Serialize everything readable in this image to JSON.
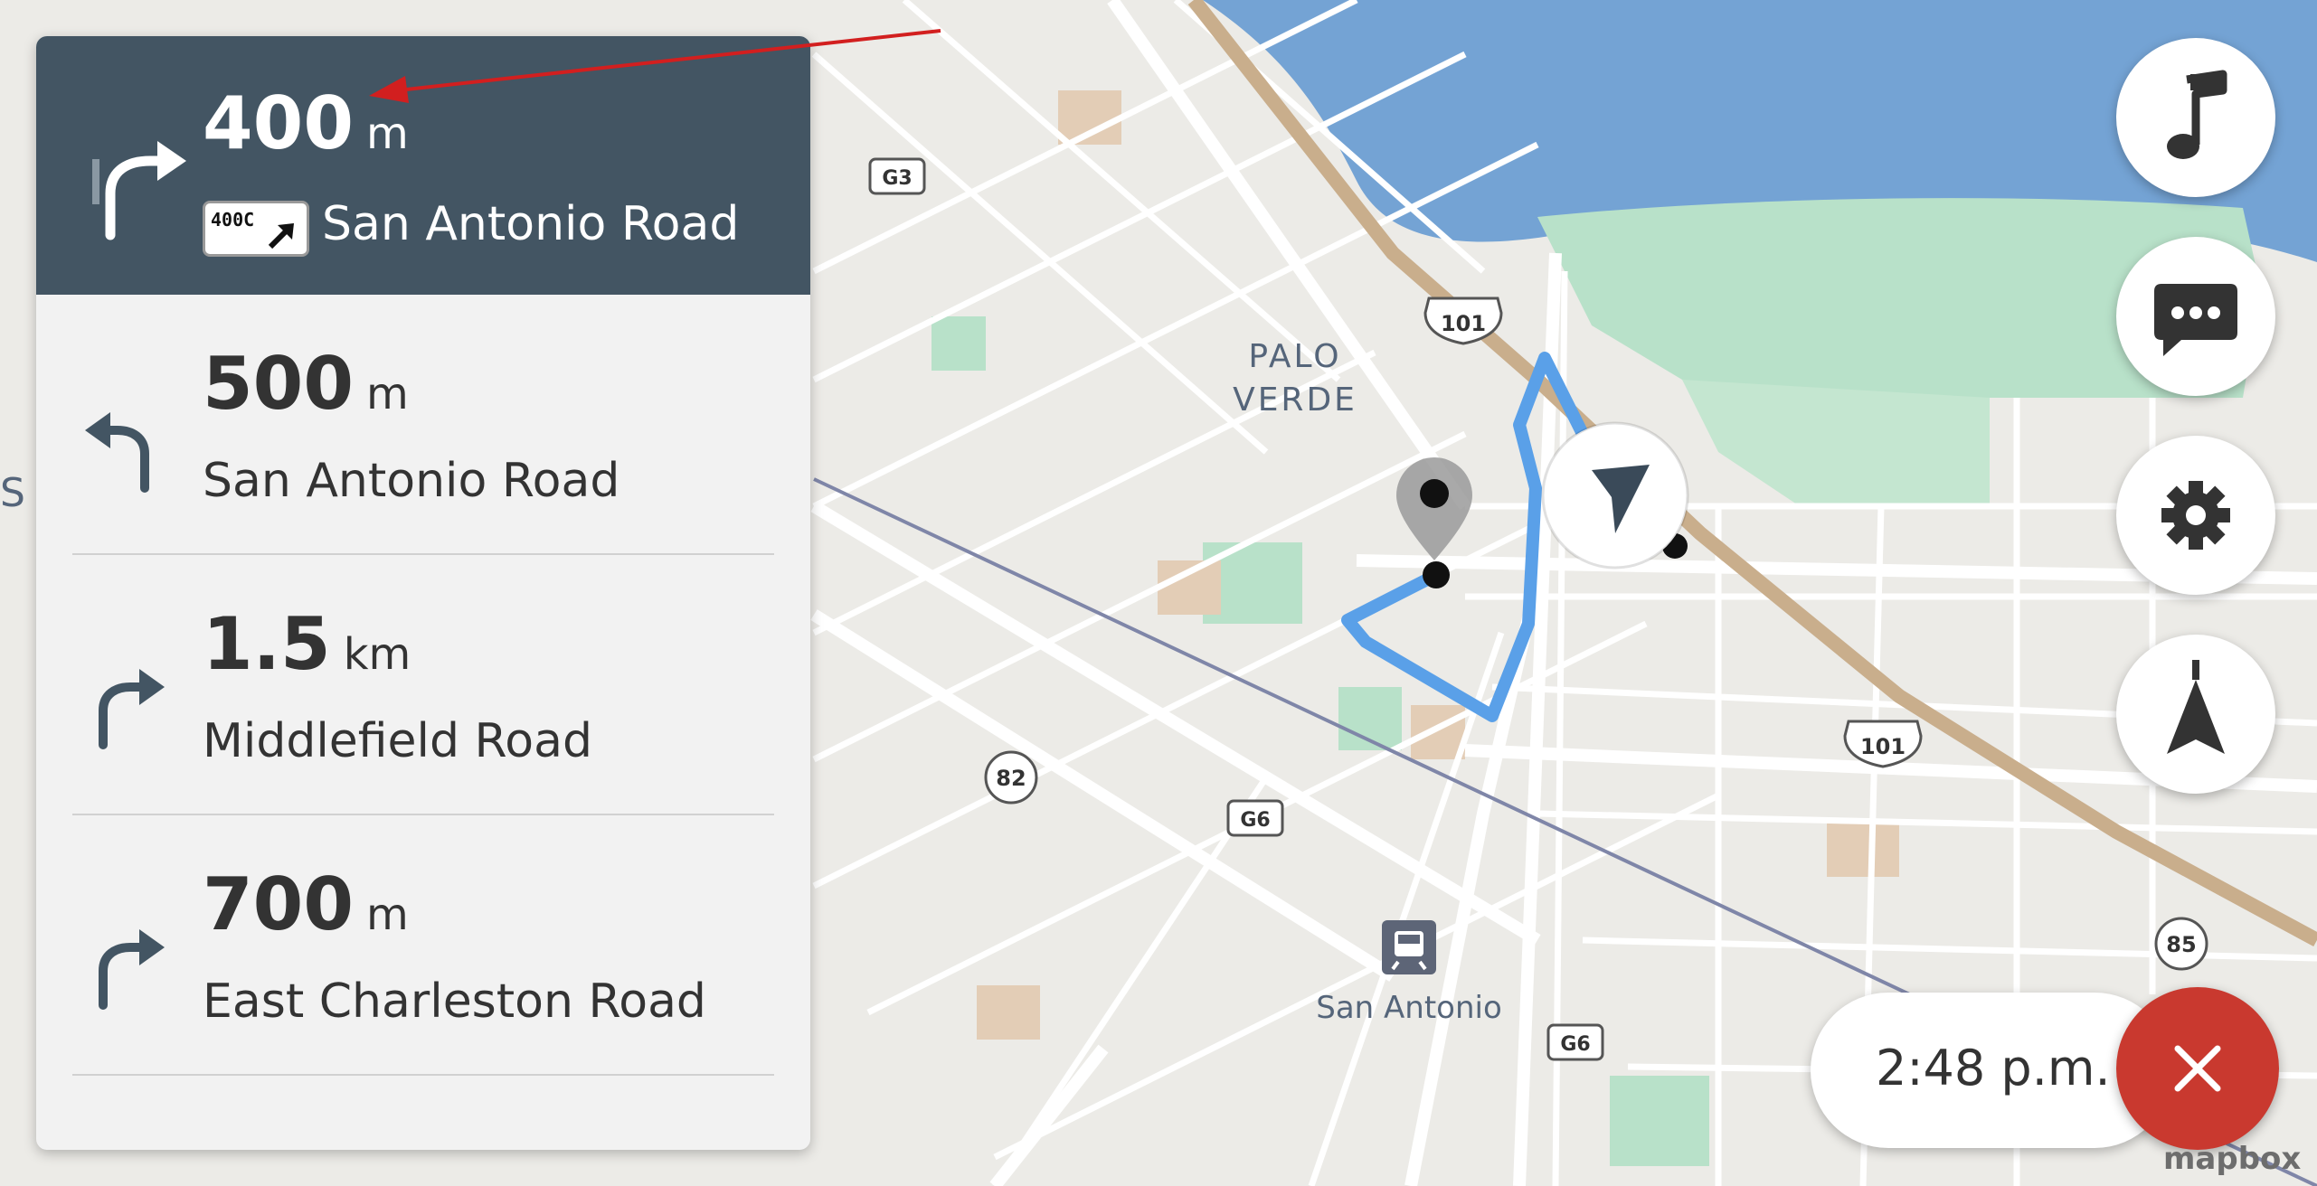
{
  "map": {
    "labels": {
      "palo_verde_1": "PALO",
      "palo_verde_2": "VERDE",
      "station": "San Antonio",
      "edge": "S",
      "shield_g3": "G3",
      "shield_101_a": "101",
      "shield_101_b": "101",
      "shield_82": "82",
      "shield_g6_a": "G6",
      "shield_g6_b": "G6",
      "shield_85": "85"
    },
    "colors": {
      "land": "#ecebe7",
      "water": "#74a3d4",
      "park": "#b8e1c9",
      "highway": "#c9ae8c",
      "route": "#5aa0e8"
    }
  },
  "steps": {
    "active": {
      "distance": "400",
      "unit": "m",
      "exit": "400C",
      "road": "San Antonio Road",
      "icon": "turn-slight-right-icon"
    },
    "list": [
      {
        "distance": "500",
        "unit": "m",
        "road": "San Antonio Road",
        "icon": "turn-left-icon"
      },
      {
        "distance": "1.5",
        "unit": "km",
        "road": "Middlefield Road",
        "icon": "turn-right-icon"
      },
      {
        "distance": "700",
        "unit": "m",
        "road": "East Charleston Road",
        "icon": "turn-right-icon"
      }
    ]
  },
  "controls": {
    "music": "music-note-icon",
    "feedback": "chat-bubble-icon",
    "settings": "gear-icon",
    "recenter": "north-arrow-icon",
    "cancel": "close-icon"
  },
  "eta": {
    "time": "2:48 p.m."
  },
  "attribution": "mapbox"
}
